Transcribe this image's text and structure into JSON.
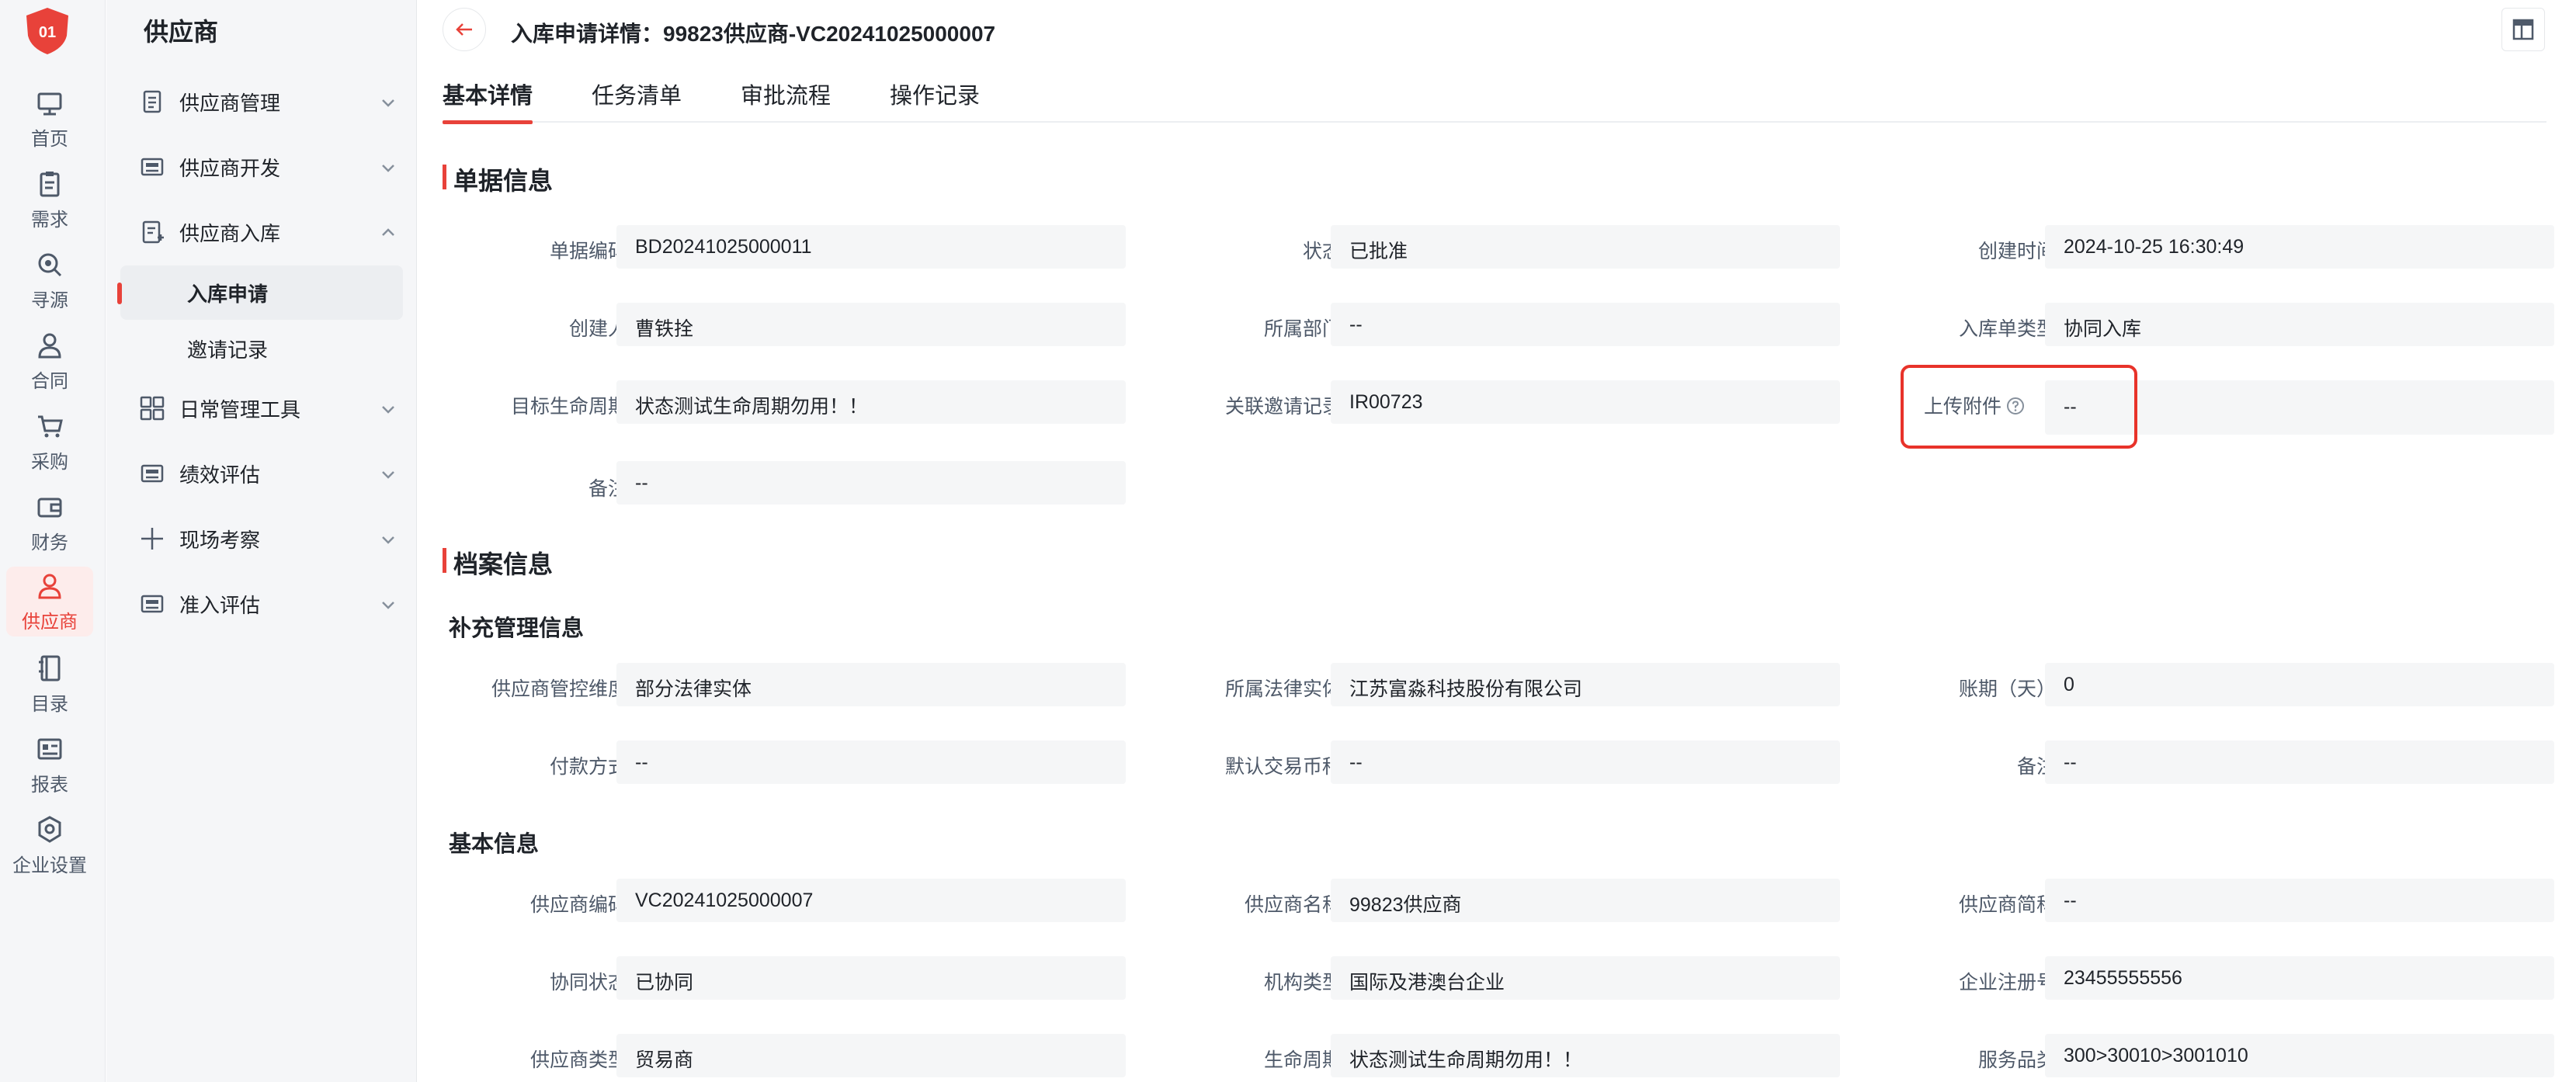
{
  "rail": {
    "logo_text": "01",
    "items": [
      {
        "label": "首页",
        "icon": "monitor-icon"
      },
      {
        "label": "需求",
        "icon": "clipboard-icon"
      },
      {
        "label": "寻源",
        "icon": "search-icon"
      },
      {
        "label": "合同",
        "icon": "user-icon"
      },
      {
        "label": "采购",
        "icon": "cart-icon"
      },
      {
        "label": "财务",
        "icon": "wallet-icon"
      },
      {
        "label": "供应商",
        "icon": "person-icon"
      },
      {
        "label": "目录",
        "icon": "book-icon"
      },
      {
        "label": "报表",
        "icon": "report-icon"
      },
      {
        "label": "企业设置",
        "icon": "settings-icon"
      }
    ]
  },
  "sidebar": {
    "title": "供应商",
    "menu": [
      {
        "label": "供应商管理",
        "icon": "doc-icon"
      },
      {
        "label": "供应商开发",
        "icon": "card-icon"
      },
      {
        "label": "供应商入库",
        "icon": "doc-edit-icon"
      },
      {
        "label": "入库申请"
      },
      {
        "label": "邀请记录"
      },
      {
        "label": "日常管理工具",
        "icon": "grid-icon"
      },
      {
        "label": "绩效评估",
        "icon": "card-icon"
      },
      {
        "label": "现场考察",
        "icon": "plus-icon"
      },
      {
        "label": "准入评估",
        "icon": "card-icon"
      }
    ]
  },
  "header": {
    "title": "入库申请详情：99823供应商-VC20241025000007"
  },
  "tabs": [
    "基本详情",
    "任务清单",
    "审批流程",
    "操作记录"
  ],
  "sections": {
    "doc_info": "单据信息",
    "archive_info": "档案信息",
    "supplement": "补充管理信息",
    "basic": "基本信息"
  },
  "doc_fields": [
    {
      "label": "单据编码",
      "value": "BD20241025000011"
    },
    {
      "label": "状态",
      "value": "已批准"
    },
    {
      "label": "创建时间",
      "value": "2024-10-25 16:30:49"
    },
    {
      "label": "创建人",
      "value": "曹铁拴"
    },
    {
      "label": "所属部门",
      "value": "--"
    },
    {
      "label": "入库单类型",
      "value": "协同入库"
    },
    {
      "label": "目标生命周期",
      "value": "状态测试生命周期勿用！！"
    },
    {
      "label": "关联邀请记录",
      "value": "IR00723"
    },
    {
      "label": "上传附件",
      "value": "--"
    },
    {
      "label": "备注",
      "value": "--"
    }
  ],
  "supplement_fields": [
    {
      "label": "供应商管控维度",
      "value": "部分法律实体"
    },
    {
      "label": "所属法律实体",
      "value": "江苏富淼科技股份有限公司"
    },
    {
      "label": "账期（天）",
      "value": "0"
    },
    {
      "label": "付款方式",
      "value": "--"
    },
    {
      "label": "默认交易币种",
      "value": "--"
    },
    {
      "label": "备注",
      "value": "--"
    }
  ],
  "basic_fields": [
    {
      "label": "供应商编码",
      "value": "VC20241025000007"
    },
    {
      "label": "供应商名称",
      "value": "99823供应商"
    },
    {
      "label": "供应商简称",
      "value": "--"
    },
    {
      "label": "协同状态",
      "value": "已协同"
    },
    {
      "label": "机构类型",
      "value": "国际及港澳台企业"
    },
    {
      "label": "企业注册号",
      "value": "23455555556"
    },
    {
      "label": "供应商类型",
      "value": "贸易商"
    },
    {
      "label": "生命周期",
      "value": "状态测试生命周期勿用！！"
    },
    {
      "label": "服务品类",
      "value": "300>30010>3001010"
    }
  ],
  "colors": {
    "accent": "#e8423a",
    "field_bg": "#f5f6f7",
    "sidebar_bg": "#f5f6f8"
  }
}
